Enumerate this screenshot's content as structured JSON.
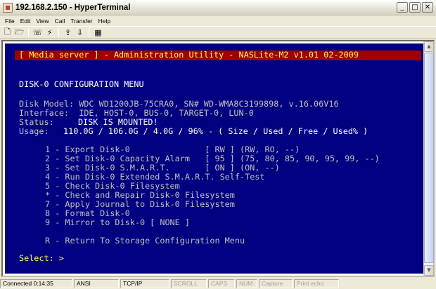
{
  "window": {
    "title": "192.168.2.150 - HyperTerminal"
  },
  "menu": [
    "File",
    "Edit",
    "View",
    "Call",
    "Transfer",
    "Help"
  ],
  "toolbar": [
    "new-document-icon",
    "open-folder-icon",
    "phone-icon",
    "disconnect-icon",
    "send-icon",
    "receive-icon",
    "properties-icon"
  ],
  "terminal": {
    "banner": "[ Media server ] - Administration Utility - NASLite-M2 v1.01 02-2009",
    "heading": "DISK-0 CONFIGURATION MENU",
    "info": {
      "model": "Disk Model: WDC WD1200JB-75CRA0, SN# WD-WMA8C3199898, v.16.06V16",
      "interface": "Interface:  IDE, HOST-0, BUS-0, TARGET-0, LUN-0",
      "status_label": "Status:",
      "status_value": "DISK IS MOUNTED!",
      "usage_label": "Usage:",
      "usage_value": "110.0G / 106.0G / 4.0G / 96% - ( Size / Used / Free / Used% )"
    },
    "options": [
      "1 - Export Disk-0               [ RW ] (RW, RO, --)",
      "2 - Set Disk-0 Capacity Alarm   [ 95 ] (75, 80, 85, 90, 95, 99, --)",
      "3 - Set Disk-0 S.M.A.R.T.       [ ON ] (ON, --)",
      "4 - Run Disk-0 Extended S.M.A.R.T. Self-Test",
      "5 - Check Disk-0 Filesystem",
      "* - Check and Repair Disk-0 Filesystem",
      "7 - Apply Journal to Disk-0 Filesystem",
      "8 - Format Disk-0",
      "9 - Mirror to Disk-0 [ NONE ]"
    ],
    "return_option": "R - Return To Storage Configuration Menu",
    "prompt": "Select: >"
  },
  "statusbar": {
    "connected": "Connected 0:14:35",
    "emulation": "ANSI",
    "protocol": "TCP/IP",
    "scroll": "SCROLL",
    "caps": "CAPS",
    "num": "NUM",
    "capture": "Capture",
    "print_echo": "Print echo"
  }
}
